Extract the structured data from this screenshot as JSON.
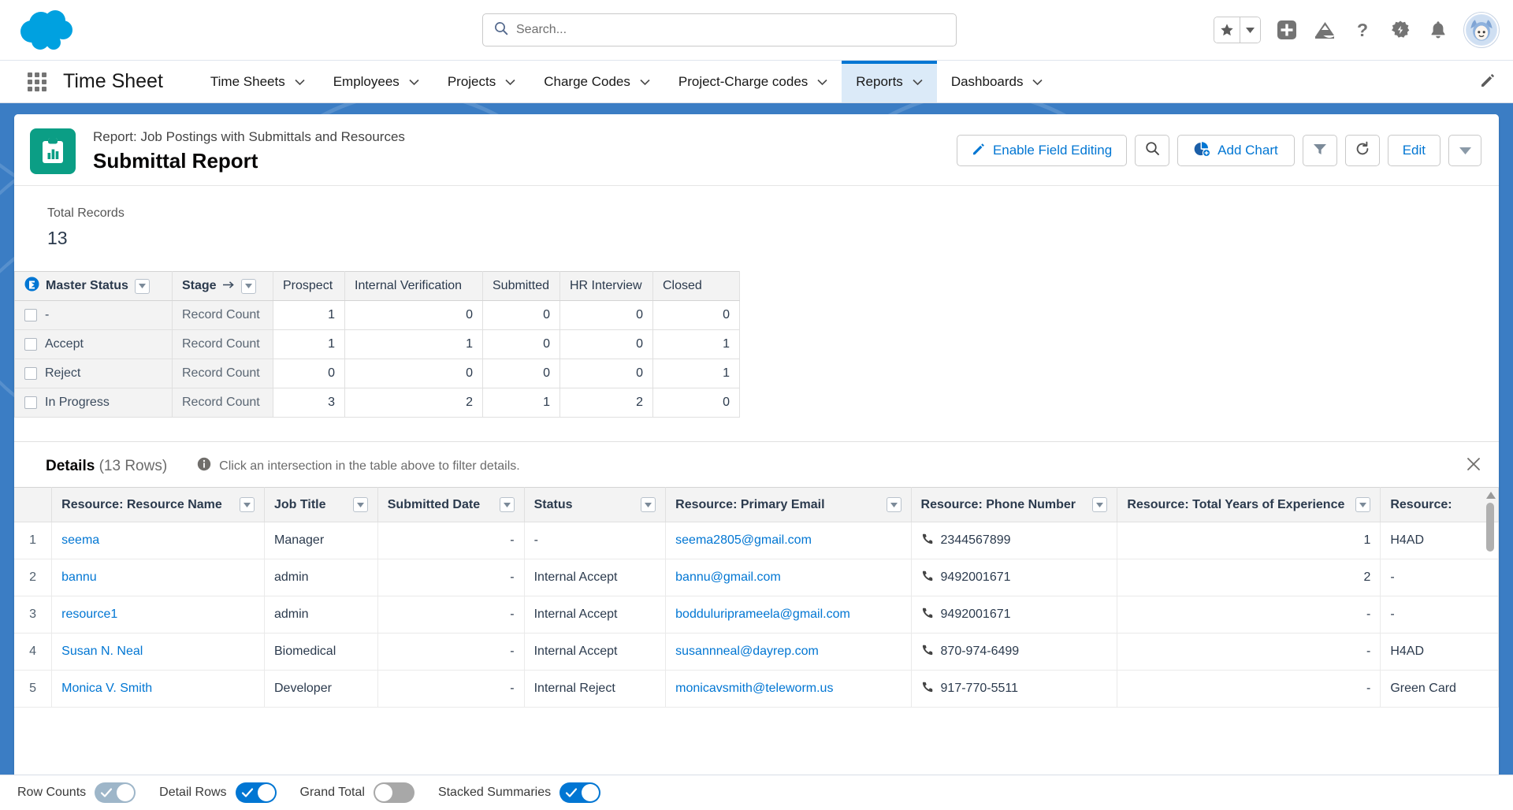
{
  "header": {
    "logo": "salesforce-cloud-logo",
    "search": {
      "placeholder": "Search...",
      "value": ""
    },
    "icons": [
      {
        "name": "favorites-star-icon"
      },
      {
        "name": "favorites-caret-icon"
      },
      {
        "name": "add-icon"
      },
      {
        "name": "mountain-icon"
      },
      {
        "name": "help-icon"
      },
      {
        "name": "setup-gear-icon"
      },
      {
        "name": "notifications-bell-icon"
      },
      {
        "name": "user-avatar"
      }
    ]
  },
  "nav": {
    "app_name": "Time Sheet",
    "items": [
      {
        "label": "Time Sheets",
        "active": false
      },
      {
        "label": "Employees",
        "active": false
      },
      {
        "label": "Projects",
        "active": false
      },
      {
        "label": "Charge Codes",
        "active": false
      },
      {
        "label": "Project-Charge codes",
        "active": false
      },
      {
        "label": "Reports",
        "active": true
      },
      {
        "label": "Dashboards",
        "active": false
      }
    ],
    "edit_icon": "pencil-icon"
  },
  "report": {
    "subtitle": "Report: Job Postings with Submittals and Resources",
    "title": "Submittal Report",
    "icon": "report-clipboard-chart-icon",
    "actions": {
      "enable_field_editing": "Enable Field Editing",
      "search": "search-icon",
      "add_chart": "Add Chart",
      "filter": "filter-icon",
      "refresh": "refresh-icon",
      "edit": "Edit",
      "more": "chevron-down-icon"
    }
  },
  "summary": {
    "total_records_label": "Total Records",
    "total_records_value": "13"
  },
  "chart_data": {
    "type": "table",
    "title": "Submittal Report summary",
    "row_group_header": "Master Status",
    "measure_header": "Stage",
    "measure_label": "Record Count",
    "categories": [
      "Prospect",
      "Internal Verification",
      "Submitted",
      "HR Interview",
      "Closed"
    ],
    "series": [
      {
        "name": "-",
        "values": [
          1,
          0,
          0,
          0,
          0
        ]
      },
      {
        "name": "Accept",
        "values": [
          1,
          1,
          0,
          0,
          1
        ]
      },
      {
        "name": "Reject",
        "values": [
          0,
          0,
          0,
          0,
          1
        ]
      },
      {
        "name": "In Progress",
        "values": [
          3,
          2,
          1,
          2,
          0
        ]
      }
    ],
    "total_records": 13,
    "grid": true,
    "legend": "none"
  },
  "details": {
    "title": "Details",
    "row_count_text": "(13 Rows)",
    "hint": "Click an intersection in the table above to filter details.",
    "close_icon": "close-icon",
    "columns": [
      "Resource: Resource Name",
      "Job Title",
      "Submitted Date",
      "Status",
      "Resource: Primary Email",
      "Resource: Phone Number",
      "Resource: Total Years of Experience",
      "Resource:"
    ],
    "rows": [
      {
        "index": "1",
        "name": "seema",
        "job_title": "Manager",
        "submitted_date": "-",
        "status": "-",
        "email": "seema2805@gmail.com",
        "phone": "2344567899",
        "experience": "1",
        "extra": "H4AD"
      },
      {
        "index": "2",
        "name": "bannu",
        "job_title": "admin",
        "submitted_date": "-",
        "status": "Internal Accept",
        "email": "bannu@gmail.com",
        "phone": "9492001671",
        "experience": "2",
        "extra": "-"
      },
      {
        "index": "3",
        "name": "resource1",
        "job_title": "admin",
        "submitted_date": "-",
        "status": "Internal Accept",
        "email": "bodduluriprameela@gmail.com",
        "phone": "9492001671",
        "experience": "-",
        "extra": "-"
      },
      {
        "index": "4",
        "name": "Susan N. Neal",
        "job_title": "Biomedical",
        "submitted_date": "-",
        "status": "Internal Accept",
        "email": "susannneal@dayrep.com",
        "phone": "870-974-6499",
        "experience": "-",
        "extra": "H4AD"
      },
      {
        "index": "5",
        "name": "Monica V. Smith",
        "job_title": "Developer",
        "submitted_date": "-",
        "status": "Internal Reject",
        "email": "monicavsmith@teleworm.us",
        "phone": "917-770-5511",
        "experience": "-",
        "extra": "Green Card"
      }
    ]
  },
  "footer": {
    "toggles": [
      {
        "label": "Row Counts",
        "state": "on-muted"
      },
      {
        "label": "Detail Rows",
        "state": "on"
      },
      {
        "label": "Grand Total",
        "state": "off"
      },
      {
        "label": "Stacked Summaries",
        "state": "on"
      }
    ]
  },
  "colors": {
    "brand_blue": "#0176d3",
    "backdrop_blue": "#3b7dc4",
    "report_icon_teal": "#0b9e85"
  }
}
